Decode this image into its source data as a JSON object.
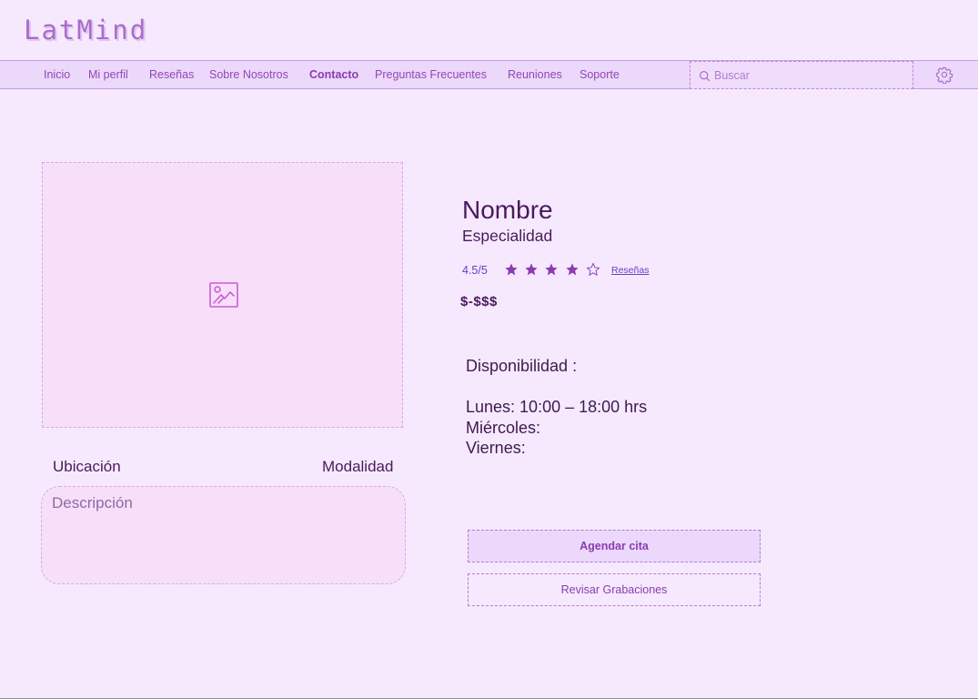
{
  "app": {
    "logo": "LatMind"
  },
  "nav": {
    "items": [
      {
        "label": "Inicio",
        "active": false
      },
      {
        "label": "Mi perfil",
        "active": false
      },
      {
        "label": "Reseñas",
        "active": false
      },
      {
        "label": "Sobre Nosotros",
        "active": false
      },
      {
        "label": "Contacto",
        "active": true
      },
      {
        "label": "Preguntas Frecuentes",
        "active": false
      },
      {
        "label": "Reuniones",
        "active": false
      },
      {
        "label": "Soporte",
        "active": false
      }
    ],
    "search": {
      "placeholder": "Buscar",
      "value": "",
      "icon": "search-icon"
    },
    "settings": {
      "icon": "gear-icon"
    }
  },
  "profile": {
    "image": {
      "icon": "image-icon"
    },
    "location_label": "Ubicación",
    "modality_label": "Modalidad",
    "description_placeholder": "Descripción",
    "name": "Nombre",
    "specialty": "Especialidad",
    "rating": {
      "text": "4.5/5",
      "filled_stars": 4,
      "total_stars": 5,
      "reviews_link": "Reseñas"
    },
    "price": "$-$$$"
  },
  "availability": {
    "title": "Disponibilidad :",
    "days": [
      "Lunes: 10:00 – 18:00 hrs",
      "Miércoles:",
      "Viernes:"
    ]
  },
  "actions": {
    "schedule_label": "Agendar cita",
    "recordings_label": "Revisar Grabaciones"
  },
  "colors": {
    "background": "#f6e9fd",
    "nav_background": "#ecd8fa",
    "accent": "#8a3cb3",
    "star": "#8a3cb3",
    "text": "#4a1a5c"
  }
}
